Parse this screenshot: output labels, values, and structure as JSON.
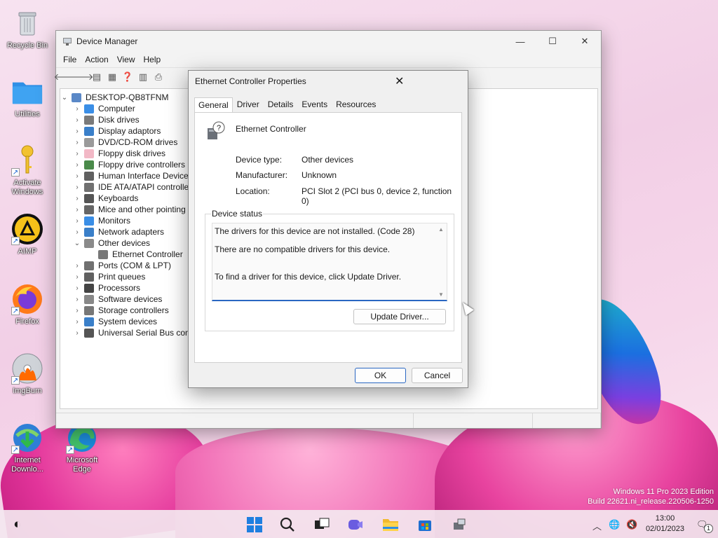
{
  "desktop": {
    "icons": [
      {
        "label": "Recycle Bin",
        "icon": "recycle-bin-icon"
      },
      {
        "label": "Utilities",
        "icon": "folder-icon"
      },
      {
        "label": "Activate Windows",
        "icon": "key-icon"
      },
      {
        "label": "AIMP",
        "icon": "aimp-icon"
      },
      {
        "label": "Firefox",
        "icon": "firefox-icon"
      },
      {
        "label": "ImgBurn",
        "icon": "imgburn-icon"
      },
      {
        "label": "Internet Downlo...",
        "icon": "internet-download-manager-icon"
      },
      {
        "label": "Microsoft Edge",
        "icon": "edge-icon"
      }
    ],
    "watermark_line1": "Windows 11 Pro 2023 Edition",
    "watermark_line2": "Build 22621.ni_release.220506-1250"
  },
  "device_manager": {
    "title": "Device Manager",
    "menu": [
      "File",
      "Action",
      "View",
      "Help"
    ],
    "root": "DESKTOP-QB8TFNM",
    "categories": [
      {
        "label": "Computer",
        "color": "#3a8ee6"
      },
      {
        "label": "Disk drives",
        "color": "#7a7a7a"
      },
      {
        "label": "Display adaptors",
        "color": "#3a7fc9"
      },
      {
        "label": "DVD/CD-ROM drives",
        "color": "#9a9a9a"
      },
      {
        "label": "Floppy disk drives",
        "color": "#f2b8c6"
      },
      {
        "label": "Floppy drive controllers",
        "color": "#4a8a4a"
      },
      {
        "label": "Human Interface Devices",
        "color": "#606060"
      },
      {
        "label": "IDE ATA/ATAPI controllers",
        "color": "#707070"
      },
      {
        "label": "Keyboards",
        "color": "#555555"
      },
      {
        "label": "Mice and other pointing devices",
        "color": "#666666"
      },
      {
        "label": "Monitors",
        "color": "#3a8ee6"
      },
      {
        "label": "Network adapters",
        "color": "#3a7fc9"
      },
      {
        "label": "Other devices",
        "color": "#8a8a8a",
        "expanded": true,
        "children": [
          "Ethernet Controller"
        ]
      },
      {
        "label": "Ports (COM & LPT)",
        "color": "#707070"
      },
      {
        "label": "Print queues",
        "color": "#606060"
      },
      {
        "label": "Processors",
        "color": "#444444"
      },
      {
        "label": "Software devices",
        "color": "#888888"
      },
      {
        "label": "Storage controllers",
        "color": "#777777"
      },
      {
        "label": "System devices",
        "color": "#3a7fc9"
      },
      {
        "label": "Universal Serial Bus controllers",
        "color": "#555555"
      }
    ]
  },
  "dialog": {
    "title": "Ethernet Controller Properties",
    "tabs": [
      "General",
      "Driver",
      "Details",
      "Events",
      "Resources"
    ],
    "device_name": "Ethernet Controller",
    "device_type_label": "Device type:",
    "device_type_value": "Other devices",
    "manufacturer_label": "Manufacturer:",
    "manufacturer_value": "Unknown",
    "location_label": "Location:",
    "location_value": "PCI Slot 2 (PCI bus 0, device 2, function 0)",
    "status_group_label": "Device status",
    "status_line1": "The drivers for this device are not installed. (Code 28)",
    "status_line2": "There are no compatible drivers for this device.",
    "status_line3": "To find a driver for this device, click Update Driver.",
    "update_driver_label": "Update Driver...",
    "ok_label": "OK",
    "cancel_label": "Cancel"
  },
  "taskbar": {
    "time": "13:00",
    "date": "02/01/2023",
    "notification_count": "1"
  }
}
